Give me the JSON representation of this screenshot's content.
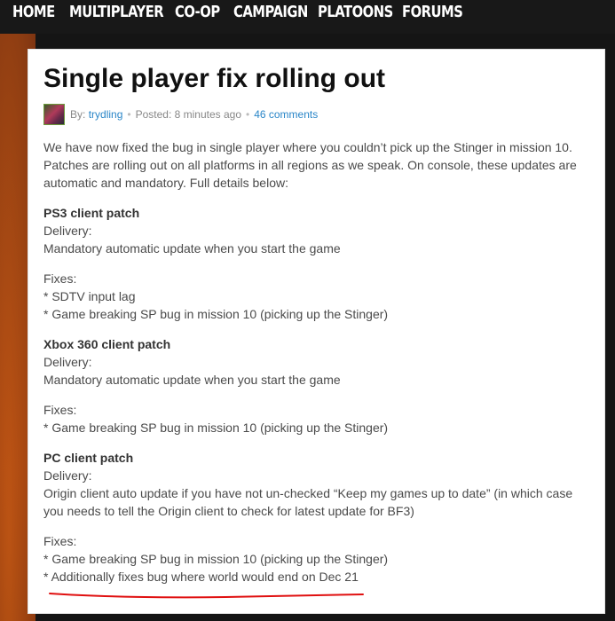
{
  "nav": {
    "items": [
      "HOME",
      "MULTIPLAYER",
      "CO-OP",
      "CAMPAIGN",
      "PLATOONS",
      "FORUMS"
    ]
  },
  "article": {
    "title": "Single player fix rolling out",
    "meta": {
      "by_label": "By:",
      "author": "trydling",
      "posted": "Posted: 8 minutes ago",
      "comments": "46 comments"
    },
    "intro": "We have now fixed the bug in single player where you couldn’t pick up the Stinger in mission 10. Patches are rolling out on all platforms in all regions as we speak. On console, these updates are automatic and mandatory. Full details below:",
    "ps3": {
      "heading": "PS3 client patch",
      "delivery_label": "Delivery:",
      "delivery": "Mandatory automatic update when you start the game",
      "fixes_label": "Fixes:",
      "fixes": [
        "* SDTV input lag",
        "* Game breaking SP bug in mission 10 (picking up the Stinger)"
      ]
    },
    "xbox": {
      "heading": "Xbox 360 client patch",
      "delivery_label": "Delivery:",
      "delivery": "Mandatory automatic update when you start the game",
      "fixes_label": "Fixes:",
      "fixes": [
        "* Game breaking SP bug in mission 10 (picking up the Stinger)"
      ]
    },
    "pc": {
      "heading": "PC client patch",
      "delivery_label": "Delivery:",
      "delivery": "Origin client auto update if you have not un-checked “Keep my games up to date” (in which case you needs to tell the Origin client to check for latest update for BF3)",
      "fixes_label": "Fixes:",
      "fixes": [
        "* Game breaking SP bug in mission 10 (picking up the Stinger)",
        "* Additionally fixes bug where world would end on Dec 21"
      ]
    }
  },
  "colors": {
    "link": "#2a86c8",
    "annotation": "#e01010"
  }
}
